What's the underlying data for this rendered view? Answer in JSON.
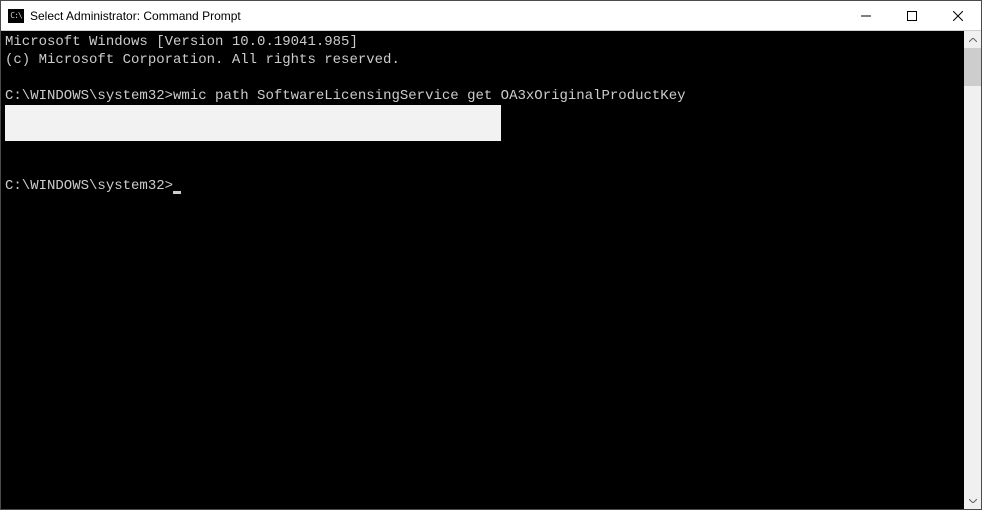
{
  "window": {
    "title": "Select Administrator: Command Prompt",
    "icon_glyph": "C:\\"
  },
  "console": {
    "line1": "Microsoft Windows [Version 10.0.19041.985]",
    "line2": "(c) Microsoft Corporation. All rights reserved.",
    "prompt1_path": "C:\\WINDOWS\\system32>",
    "prompt1_command": "wmic path SoftwareLicensingService get OA3xOriginalProductKey",
    "prompt2_path": "C:\\WINDOWS\\system32>"
  }
}
